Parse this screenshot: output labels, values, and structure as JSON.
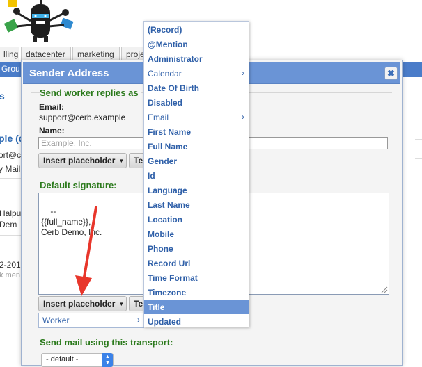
{
  "background": {
    "tabs": [
      "lling",
      "datacenter",
      "marketing",
      "proje"
    ],
    "bar_text": "Grou",
    "fragments": {
      "s": "s",
      "link": "ple (d",
      "support": "ort@c",
      "mail": "y Mail",
      "halpu": "Halpu",
      "demo": "Dem",
      "date": "2-201",
      "k_men": "k men"
    }
  },
  "dialog": {
    "title": "Sender Address",
    "close_glyph": "✖",
    "replies_legend": "Send worker replies as",
    "email_label": "Email:",
    "email_value": "support@cerb.example",
    "name_label": "Name:",
    "name_placeholder": "Example, Inc.",
    "insert_placeholder_label": "Insert placeholder",
    "test_label": "Tes",
    "signature_legend": "Default signature:",
    "signature_text": "--\n{{full_name}},\nCerb Demo, Inc.",
    "insert_placeholder_label_2": "Insert placeholder",
    "test_label_2": "Tes",
    "worker_select": "Worker",
    "transport_legend": "Send mail using this transport:",
    "transport_value": "- default -"
  },
  "menu": {
    "items": [
      {
        "label": "(Record)",
        "submenu": false
      },
      {
        "label": "@Mention",
        "submenu": false
      },
      {
        "label": "Administrator",
        "submenu": false
      },
      {
        "label": "Calendar",
        "submenu": true
      },
      {
        "label": "Date Of Birth",
        "submenu": false
      },
      {
        "label": "Disabled",
        "submenu": false
      },
      {
        "label": "Email",
        "submenu": true
      },
      {
        "label": "First Name",
        "submenu": false
      },
      {
        "label": "Full Name",
        "submenu": false
      },
      {
        "label": "Gender",
        "submenu": false
      },
      {
        "label": "Id",
        "submenu": false
      },
      {
        "label": "Language",
        "submenu": false
      },
      {
        "label": "Last Name",
        "submenu": false
      },
      {
        "label": "Location",
        "submenu": false
      },
      {
        "label": "Mobile",
        "submenu": false
      },
      {
        "label": "Phone",
        "submenu": false
      },
      {
        "label": "Record Url",
        "submenu": false
      },
      {
        "label": "Time Format",
        "submenu": false
      },
      {
        "label": "Timezone",
        "submenu": false
      },
      {
        "label": "Title",
        "submenu": false
      },
      {
        "label": "Updated",
        "submenu": false
      }
    ],
    "highlighted_index": 19,
    "submenu_glyph": "›"
  },
  "colors": {
    "accent": "#6a94d6",
    "legend_green": "#2b7a1c",
    "link_blue": "#2e5fa8",
    "annotation_arrow": "#e8362b"
  }
}
